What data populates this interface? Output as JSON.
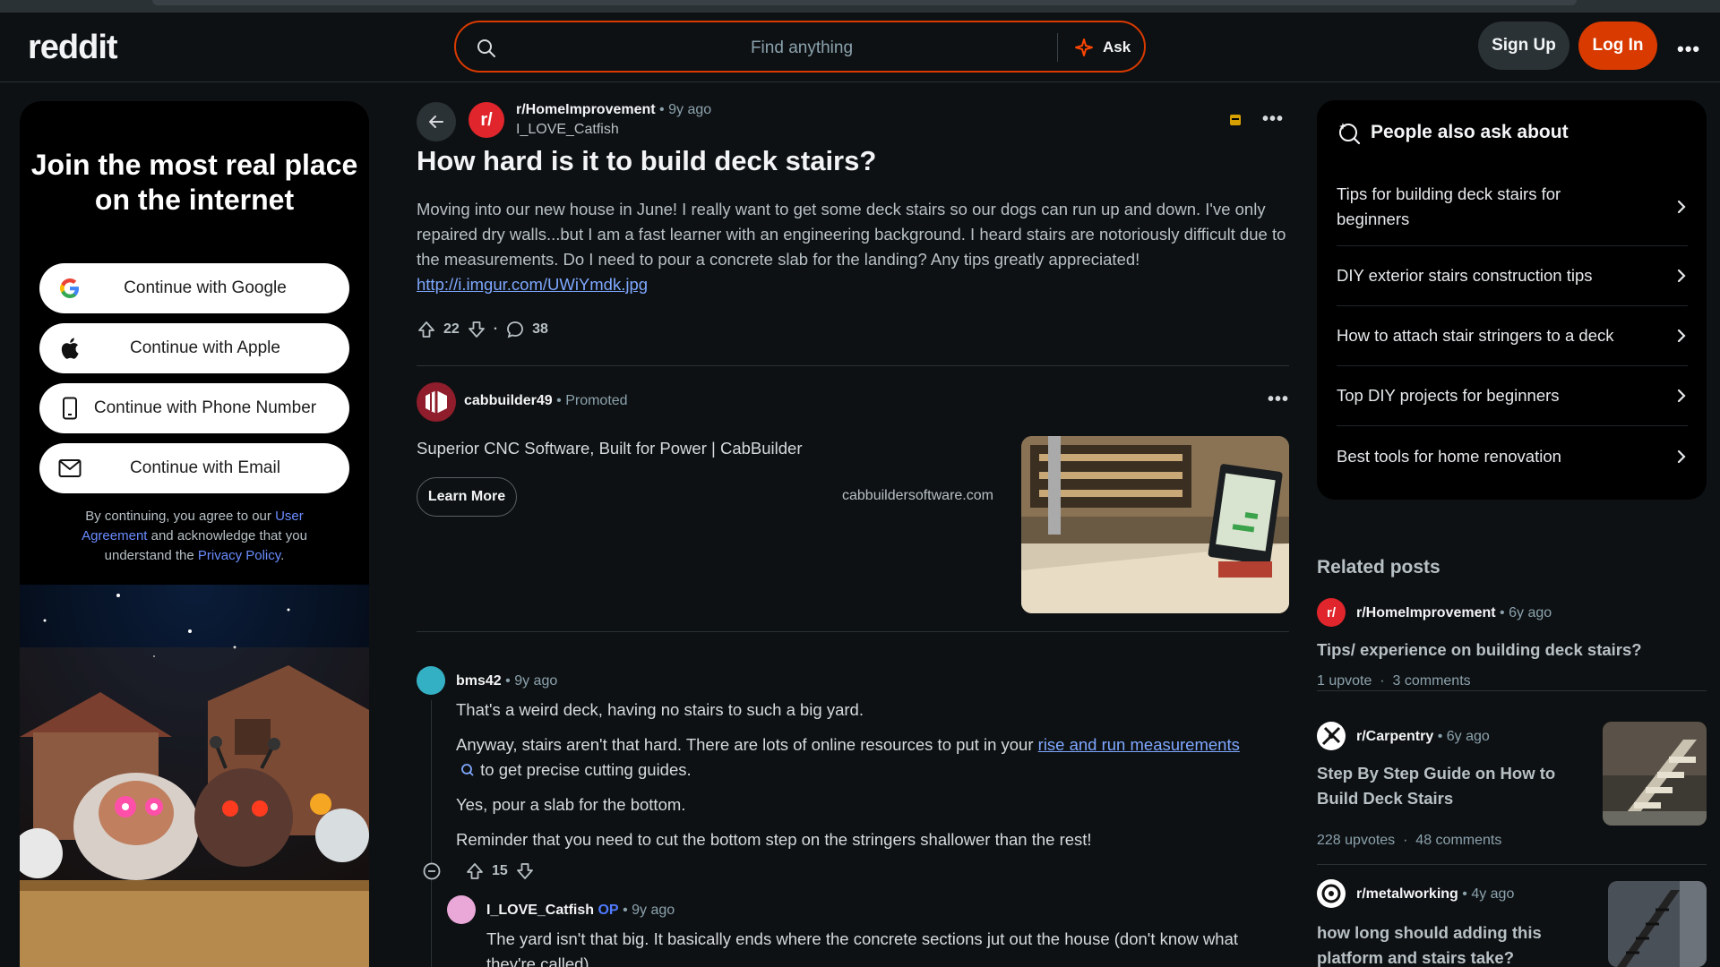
{
  "header": {
    "logo": "reddit",
    "search_placeholder": "Find anything",
    "ask_label": "Ask",
    "signup_label": "Sign Up",
    "login_label": "Log In"
  },
  "left_panel": {
    "title": "Join the most real place on the internet",
    "buttons": [
      {
        "label": "Continue with Google",
        "icon": "google-icon"
      },
      {
        "label": "Continue with Apple",
        "icon": "apple-icon"
      },
      {
        "label": "Continue with Phone Number",
        "icon": "phone-icon"
      },
      {
        "label": "Continue with Email",
        "icon": "mail-icon"
      }
    ],
    "legal": {
      "p1": "By continuing, you agree to our ",
      "link1": "User Agreement",
      "p2": " and acknowledge that you understand the ",
      "link2": "Privacy Policy",
      "p3": "."
    }
  },
  "post": {
    "subreddit": "r/HomeImprovement",
    "age": "9y ago",
    "author": "I_LOVE_Catfish",
    "title": "How hard is it to build deck stairs?",
    "body": "Moving into our new house in June! I really want to get some deck stairs so our dogs can run up and down. I've only repaired dry walls...but I am a fast learner with an engineering background. I heard stairs are notoriously difficult due to the measurements. Do I need to pour a concrete slab for the landing? Any tips greatly appreciated!",
    "link": "http://i.imgur.com/UWiYmdk.jpg",
    "upvotes": "22",
    "comments": "38"
  },
  "promo": {
    "name": "cabbuilder49",
    "label": "Promoted",
    "text": "Superior CNC Software, Built for Power | CabBuilder",
    "cta": "Learn More",
    "domain": "cabbuildersoftware.com"
  },
  "comments": [
    {
      "user": "bms42",
      "age": "9y ago",
      "line1": "That's a weird deck, having no stairs to such a big yard.",
      "line2a": "Anyway, stairs aren't that hard. There are lots of online resources to put in your ",
      "line2link": "rise and run measurements",
      "line2b": " to get precise cutting guides.",
      "line3": "Yes, pour a slab for the bottom.",
      "line4": "Reminder that you need to cut the bottom step on the stringers shallower than the rest!",
      "votes": "15"
    },
    {
      "user": "I_LOVE_Catfish",
      "op": "OP",
      "age": "9y ago",
      "text": "The yard isn't that big. It basically ends where the concrete sections jut out the house (don't know what they're called)."
    }
  ],
  "sidebar": {
    "ask_title": "People also ask about",
    "ask_items": [
      "Tips for building deck stairs for beginners",
      "DIY exterior stairs construction tips",
      "How to attach stair stringers to a deck",
      "Top DIY projects for beginners",
      "Best tools for home renovation"
    ],
    "related_title": "Related posts",
    "related": [
      {
        "sub": "r/HomeImprovement",
        "age": "6y ago",
        "title": "Tips/ experience on building deck stairs?",
        "upvotes": "1 upvote",
        "comments": "3 comments"
      },
      {
        "sub": "r/Carpentry",
        "age": "6y ago",
        "title": "Step By Step Guide on How to Build Deck Stairs",
        "upvotes": "228 upvotes",
        "comments": "48 comments"
      },
      {
        "sub": "r/metalworking",
        "age": "4y ago",
        "title": "how long should adding this platform and stairs take?"
      }
    ]
  },
  "colors": {
    "accent": "#d93a00",
    "link": "#7ea8ff",
    "bg": "#0e1113"
  }
}
